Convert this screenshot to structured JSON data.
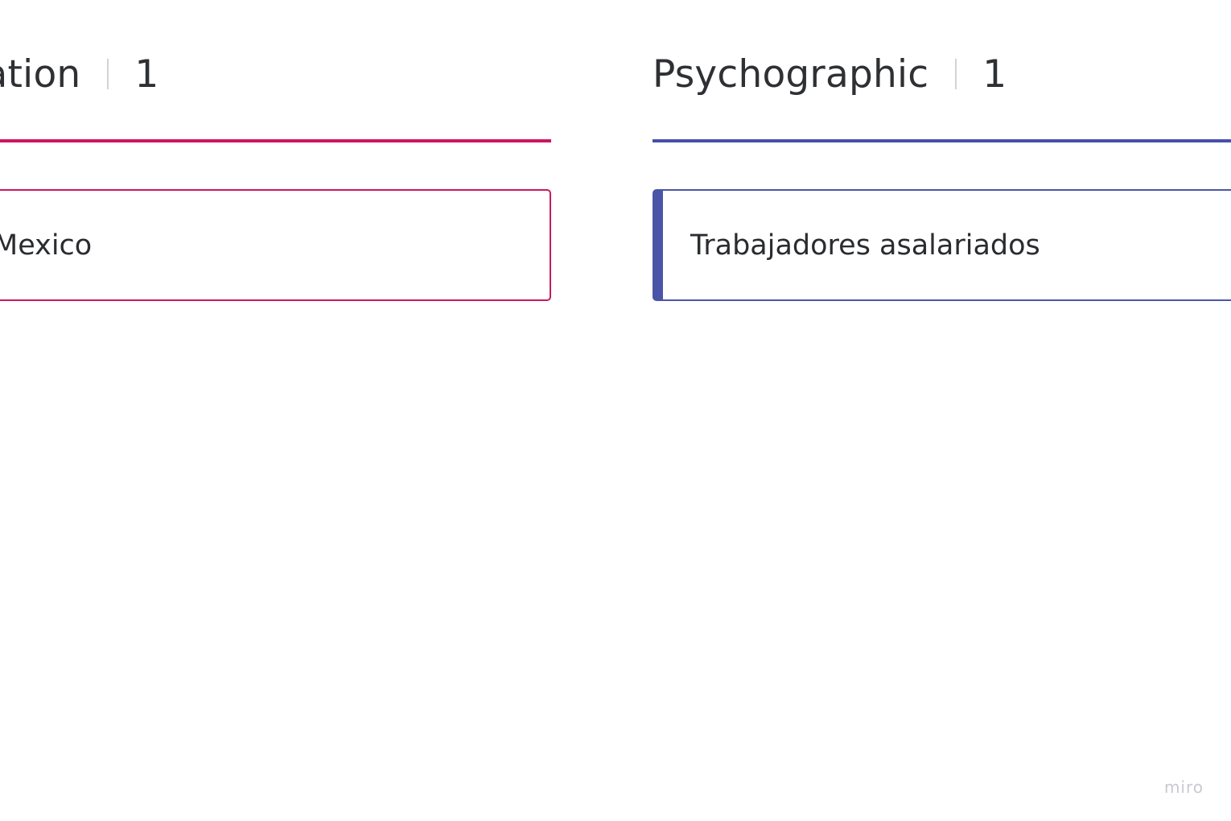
{
  "columns": [
    {
      "title": "Location",
      "count": "1",
      "color": "#d1135f",
      "cards": [
        "Mexico"
      ]
    },
    {
      "title": "Psychographic",
      "count": "1",
      "color": "#4550ab",
      "cards": [
        "Trabajadores asalariados"
      ]
    }
  ],
  "watermark": "miro"
}
